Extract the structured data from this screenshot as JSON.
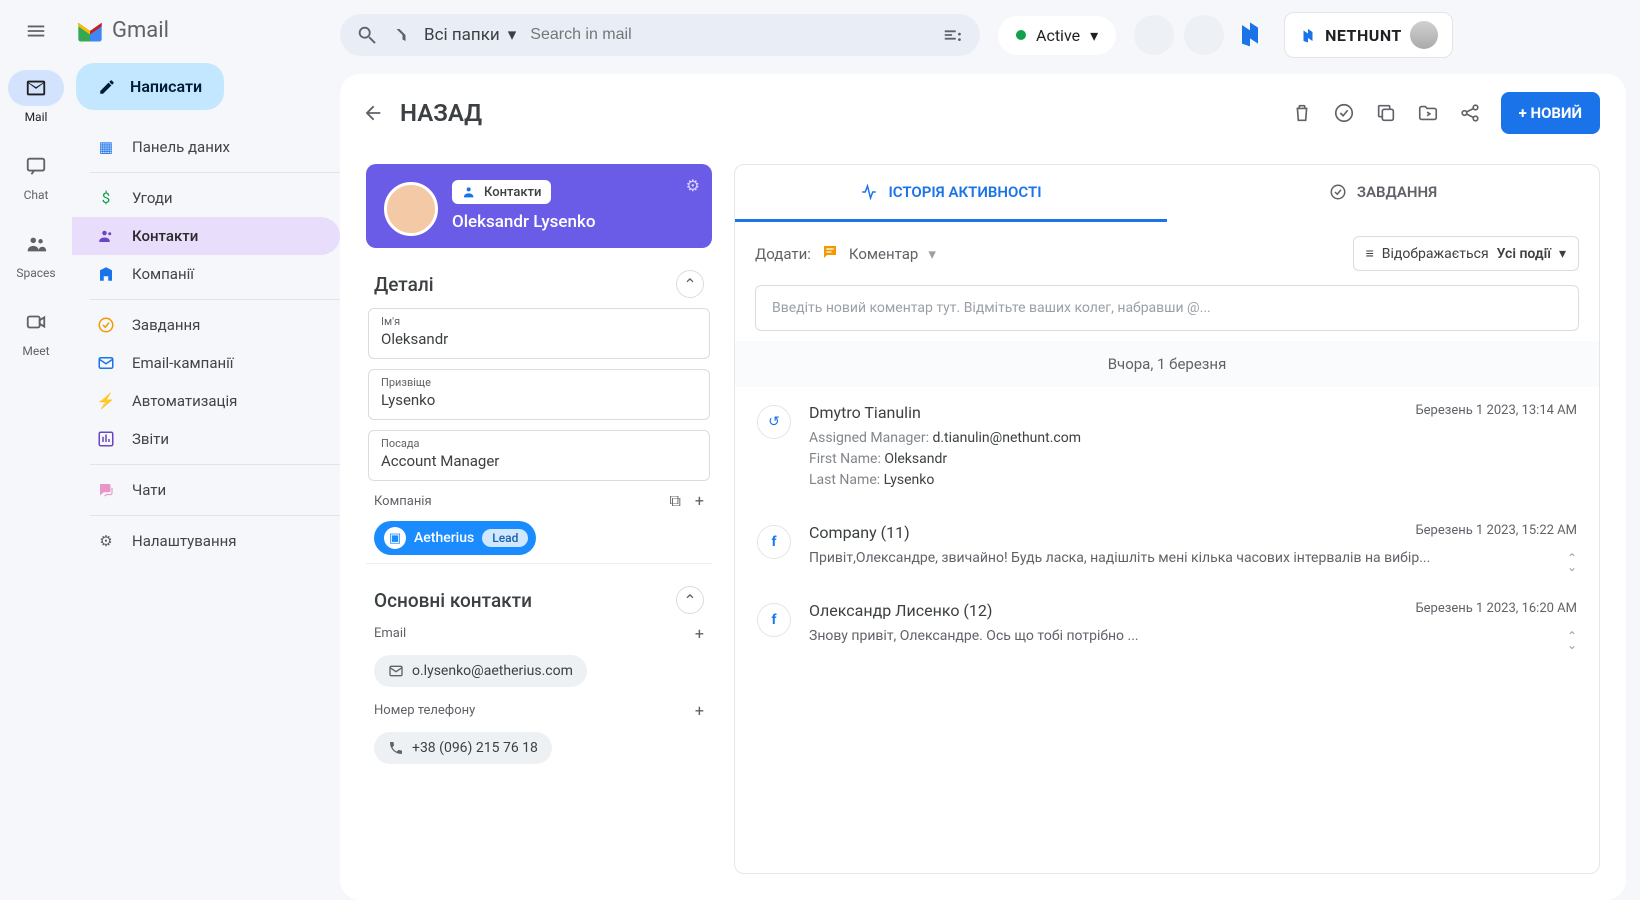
{
  "brand": "Gmail",
  "compose_label": "Написати",
  "rail": {
    "mail": "Mail",
    "chat": "Chat",
    "spaces": "Spaces",
    "meet": "Meet"
  },
  "search": {
    "folders_label": "Всі папки",
    "placeholder": "Search in mail"
  },
  "status": {
    "label": "Active"
  },
  "nethunt": "NETHUNT",
  "nav": {
    "dashboard": "Панель даних",
    "deals": "Угоди",
    "contacts": "Контакти",
    "companies": "Компанії",
    "tasks": "Завдання",
    "campaigns": "Email-кампанії",
    "automation": "Автоматизація",
    "reports": "Звіти",
    "chats": "Чати",
    "settings": "Налаштування"
  },
  "record": {
    "back": "НАЗАД",
    "new_btn": "+ НОВИЙ",
    "folder_chip": "Контакти",
    "name": "Oleksandr Lysenko",
    "details_title": "Деталі",
    "primary_title": "Основні контакти",
    "fields": {
      "first_name_lbl": "Ім'я",
      "first_name_val": "Oleksandr",
      "last_name_lbl": "Призвіще",
      "last_name_val": "Lysenko",
      "position_lbl": "Посада",
      "position_val": "Account Manager"
    },
    "company_lbl": "Компанія",
    "company_name": "Aetherius",
    "company_stage": "Lead",
    "email_lbl": "Email",
    "email_val": "o.lysenko@aetherius.com",
    "phone_lbl": "Номер телефону",
    "phone_val": "+38 (096) 215 76 18"
  },
  "tabs": {
    "activity": "ІСТОРІЯ АКТИВНОСТІ",
    "tasks": "ЗАВДАННЯ"
  },
  "filter": {
    "add_label": "Додати:",
    "comment": "Коментар",
    "display": "Відображається",
    "display_val": "Усі події"
  },
  "comment_placeholder": "Введіть новий коментар тут. Відмітьте ваших колег, набравши @...",
  "timeline": {
    "date_sep": "Вчора, 1 березня",
    "items": [
      {
        "icon": "history",
        "title": "Dmytro Tianulin",
        "time": "Березень 1 2023, 13:14 AM",
        "lines": [
          {
            "k": "Assigned Manager:",
            "v": "d.tianulin@nethunt.com"
          },
          {
            "k": "First Name:",
            "v": "Oleksandr"
          },
          {
            "k": "Last Name:",
            "v": "Lysenko"
          }
        ]
      },
      {
        "icon": "fb",
        "title": "Company (11)",
        "time": "Березень 1 2023, 15:22 AM",
        "body": "Привіт,Олександре, звичайно! Будь ласка, надішліть мені кілька часових інтервалів на вибір..."
      },
      {
        "icon": "fb",
        "title": "Олександр Лисенко (12)",
        "time": "Березень 1 2023, 16:20 AM",
        "body": "Знову привіт, Олександре. Ось що тобі потрібно ..."
      }
    ]
  }
}
